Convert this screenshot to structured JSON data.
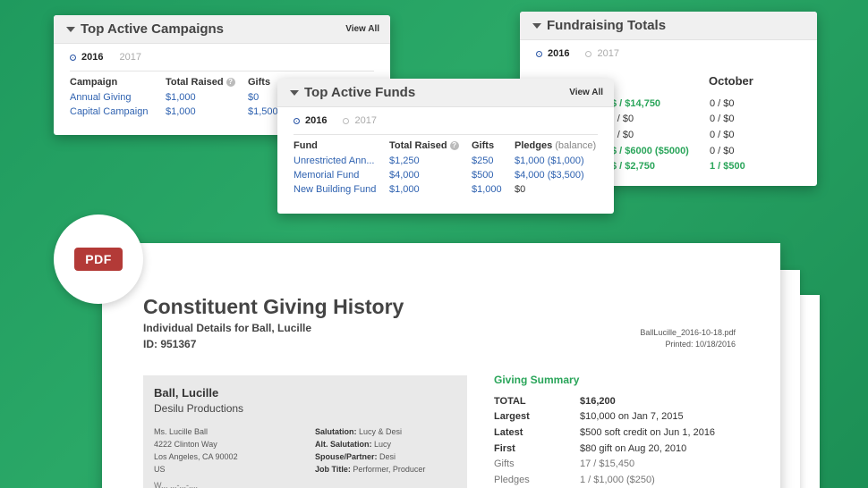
{
  "campaigns": {
    "title": "Top Active Campaigns",
    "view_all": "View All",
    "years": [
      "2016",
      "2017"
    ],
    "headers": [
      "Campaign",
      "Total Raised",
      "Gifts"
    ],
    "rows": [
      {
        "name": "Annual Giving",
        "raised": "$1,000",
        "gifts": "$0"
      },
      {
        "name": "Capital Campaign",
        "raised": "$1,000",
        "gifts": "$1,500"
      }
    ]
  },
  "totals": {
    "title": "Fundraising Totals",
    "years": [
      "2016",
      "2017"
    ],
    "col_header": "October",
    "rows": [
      {
        "left": "$ / $14,750",
        "right": "0 / $0",
        "left_green": true,
        "right_green": false
      },
      {
        "left": ") / $0",
        "right": "0 / $0",
        "left_green": false,
        "right_green": false
      },
      {
        "left": ") / $0",
        "right": "0 / $0",
        "left_green": false,
        "right_green": false
      },
      {
        "left": "$ / $6000 ($5000)",
        "right": "0 / $0",
        "left_green": true,
        "right_green": false
      },
      {
        "left": "$ / $2,750",
        "right": "1 / $500",
        "left_green": true,
        "right_green": true
      }
    ]
  },
  "funds": {
    "title": "Top Active Funds",
    "view_all": "View All",
    "years": [
      "2016",
      "2017"
    ],
    "headers": [
      "Fund",
      "Total Raised",
      "Gifts",
      "Pledges",
      "(balance)"
    ],
    "rows": [
      {
        "name": "Unrestricted Ann...",
        "raised": "$1,250",
        "gifts": "$250",
        "pledges": "$1,000 ($1,000)"
      },
      {
        "name": "Memorial Fund",
        "raised": "$4,000",
        "gifts": "$500",
        "pledges": "$4,000 ($3,500)"
      },
      {
        "name": "New Building Fund",
        "raised": "$1,000",
        "gifts": "$1,000",
        "pledges": "$0"
      }
    ]
  },
  "pdf_badge": "PDF",
  "doc": {
    "title": "Constituent Giving History",
    "subtitle": "Individual Details for Ball, Lucille",
    "id": "ID: 951367",
    "filename": "BallLucille_2016-10-18.pdf",
    "printed": "Printed: 10/18/2016",
    "name": "Ball, Lucille",
    "org": "Desilu Productions",
    "address": [
      "Ms. Lucille Ball",
      "4222 Clinton Way",
      "Los Angeles, CA 90002",
      "US"
    ],
    "info": [
      {
        "k": "Salutation:",
        "v": "Lucy & Desi"
      },
      {
        "k": "Alt. Salutation:",
        "v": "Lucy"
      },
      {
        "k": "Spouse/Partner:",
        "v": "Desi"
      },
      {
        "k": "Job Title:",
        "v": "Performer, Producer"
      }
    ],
    "cut_text": "W...  ...-...-....",
    "summary_title": "Giving Summary",
    "summary": [
      {
        "k": "TOTAL",
        "v": "$16,200"
      },
      {
        "k": "Largest",
        "v": "$10,000 on Jan 7, 2015"
      },
      {
        "k": "Latest",
        "v": "$500 soft credit on Jun 1, 2016"
      },
      {
        "k": "First",
        "v": "$80 gift on Aug 20, 2010"
      },
      {
        "k": "Gifts",
        "v": "17 / $15,450"
      },
      {
        "k": "Pledges",
        "v": "1 / $1,000 ($250)"
      }
    ]
  }
}
